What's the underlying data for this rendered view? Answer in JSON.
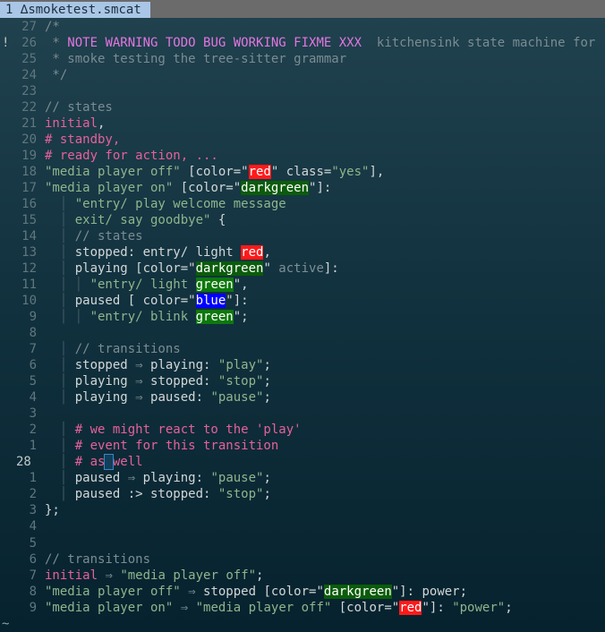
{
  "tab": {
    "number": "1",
    "icon": "linux-icon",
    "filename": "smoketest.smcat"
  },
  "cursor_line": "28",
  "lines": [
    {
      "n": "27",
      "s": [
        [
          "/*",
          "cm"
        ]
      ]
    },
    {
      "n": "26",
      "sign": "!",
      "s": [
        [
          " * ",
          "cm"
        ],
        [
          "NOTE WARNING TODO BUG WORKING FIXME XXX",
          "todo"
        ],
        [
          "  kitchensink state machine for",
          "cm"
        ]
      ]
    },
    {
      "n": "25",
      "s": [
        [
          " * smoke testing the tree-sitter grammar",
          "cm"
        ]
      ]
    },
    {
      "n": "24",
      "s": [
        [
          " */",
          "cm"
        ]
      ]
    },
    {
      "n": "23",
      "s": []
    },
    {
      "n": "22",
      "s": [
        [
          "// states",
          "cm"
        ]
      ]
    },
    {
      "n": "21",
      "s": [
        [
          "initial",
          "kw"
        ],
        [
          ",",
          "tx"
        ]
      ]
    },
    {
      "n": "20",
      "s": [
        [
          "# standby,",
          "kw"
        ]
      ]
    },
    {
      "n": "19",
      "s": [
        [
          "# ready for action, ...",
          "kw"
        ]
      ]
    },
    {
      "n": "18",
      "s": [
        [
          "\"media player off\"",
          "str"
        ],
        [
          " [color=\"",
          "tx"
        ],
        [
          "red",
          "red"
        ],
        [
          "\" class=",
          "tx"
        ],
        [
          "\"yes\"",
          "str"
        ],
        [
          "],",
          "tx"
        ]
      ]
    },
    {
      "n": "17",
      "s": [
        [
          "\"media player on\"",
          "str"
        ],
        [
          " [color=\"",
          "tx"
        ],
        [
          "darkgreen",
          "dg"
        ],
        [
          "\"]:",
          "tx"
        ]
      ]
    },
    {
      "n": "16",
      "s": [
        [
          "  | ",
          "guide"
        ],
        [
          "\"entry/ play welcome message",
          "str"
        ]
      ]
    },
    {
      "n": "15",
      "s": [
        [
          "  | ",
          "guide"
        ],
        [
          "exit/ say goodbye\"",
          "str"
        ],
        [
          " {",
          "tx"
        ]
      ]
    },
    {
      "n": "14",
      "s": [
        [
          "  | ",
          "guide"
        ],
        [
          "// states",
          "cm"
        ]
      ]
    },
    {
      "n": "13",
      "s": [
        [
          "  | ",
          "guide"
        ],
        [
          "stopped: entry/ light ",
          "tx"
        ],
        [
          "red",
          "red"
        ],
        [
          ",",
          "tx"
        ]
      ]
    },
    {
      "n": "12",
      "s": [
        [
          "  | ",
          "guide"
        ],
        [
          "playing [color=\"",
          "tx"
        ],
        [
          "darkgreen",
          "dg"
        ],
        [
          "\" ",
          "tx"
        ],
        [
          "active",
          "op"
        ],
        [
          "]:",
          "tx"
        ]
      ]
    },
    {
      "n": "11",
      "s": [
        [
          "  | | ",
          "guide"
        ],
        [
          "\"entry/ light ",
          "str"
        ],
        [
          "green",
          "g"
        ],
        [
          "\",",
          "tx"
        ]
      ]
    },
    {
      "n": "10",
      "s": [
        [
          "  | ",
          "guide"
        ],
        [
          "paused [ color=\"",
          "tx"
        ],
        [
          "blue",
          "blue"
        ],
        [
          "\"]:",
          "tx"
        ]
      ]
    },
    {
      "n": "9",
      "s": [
        [
          "  | | ",
          "guide"
        ],
        [
          "\"entry/ blink ",
          "str"
        ],
        [
          "green",
          "g"
        ],
        [
          "\";",
          "tx"
        ]
      ]
    },
    {
      "n": "8",
      "s": []
    },
    {
      "n": "7",
      "s": [
        [
          "  | ",
          "guide"
        ],
        [
          "// transitions",
          "cm"
        ]
      ]
    },
    {
      "n": "6",
      "s": [
        [
          "  | ",
          "guide"
        ],
        [
          "stopped ",
          "tx"
        ],
        [
          "⇒",
          "op"
        ],
        [
          " playing: ",
          "tx"
        ],
        [
          "\"play\"",
          "str"
        ],
        [
          ";",
          "tx"
        ]
      ]
    },
    {
      "n": "5",
      "s": [
        [
          "  | ",
          "guide"
        ],
        [
          "playing ",
          "tx"
        ],
        [
          "⇒",
          "op"
        ],
        [
          " stopped: ",
          "tx"
        ],
        [
          "\"stop\"",
          "str"
        ],
        [
          ";",
          "tx"
        ]
      ]
    },
    {
      "n": "4",
      "s": [
        [
          "  | ",
          "guide"
        ],
        [
          "playing ",
          "tx"
        ],
        [
          "⇒",
          "op"
        ],
        [
          " paused: ",
          "tx"
        ],
        [
          "\"pause\"",
          "str"
        ],
        [
          ";",
          "tx"
        ]
      ]
    },
    {
      "n": "3",
      "s": []
    },
    {
      "n": "2",
      "s": [
        [
          "  | ",
          "guide"
        ],
        [
          "# we might react to the 'play'",
          "kw"
        ]
      ]
    },
    {
      "n": "1",
      "s": [
        [
          "  | ",
          "guide"
        ],
        [
          "# event for this transition",
          "kw"
        ]
      ]
    },
    {
      "n": "28",
      "cur": true,
      "s": [
        [
          "  | ",
          "guide"
        ],
        [
          "# as",
          "kw"
        ],
        [
          " ",
          "cursor"
        ],
        [
          "well",
          "kw"
        ]
      ]
    },
    {
      "n": "1",
      "s": [
        [
          "  | ",
          "guide"
        ],
        [
          "paused ",
          "tx"
        ],
        [
          "⇒",
          "op"
        ],
        [
          " playing: ",
          "tx"
        ],
        [
          "\"pause\"",
          "str"
        ],
        [
          ";",
          "tx"
        ]
      ]
    },
    {
      "n": "2",
      "s": [
        [
          "  | ",
          "guide"
        ],
        [
          "paused :> stopped: ",
          "tx"
        ],
        [
          "\"stop\"",
          "str"
        ],
        [
          ";",
          "tx"
        ]
      ]
    },
    {
      "n": "3",
      "s": [
        [
          "};",
          "tx"
        ]
      ]
    },
    {
      "n": "4",
      "s": []
    },
    {
      "n": "5",
      "s": []
    },
    {
      "n": "6",
      "s": [
        [
          "// transitions",
          "cm"
        ]
      ]
    },
    {
      "n": "7",
      "s": [
        [
          "initial",
          "kw"
        ],
        [
          " ",
          "tx"
        ],
        [
          "⇒",
          "op"
        ],
        [
          " ",
          "tx"
        ],
        [
          "\"media player off\"",
          "str"
        ],
        [
          ";",
          "tx"
        ]
      ]
    },
    {
      "n": "8",
      "s": [
        [
          "\"media player off\"",
          "str"
        ],
        [
          " ",
          "tx"
        ],
        [
          "⇒",
          "op"
        ],
        [
          " stopped [color=\"",
          "tx"
        ],
        [
          "darkgreen",
          "dg"
        ],
        [
          "\"]: power;",
          "tx"
        ]
      ]
    },
    {
      "n": "9",
      "s": [
        [
          "\"media player on\"",
          "str"
        ],
        [
          " ",
          "tx"
        ],
        [
          "⇒",
          "op"
        ],
        [
          " ",
          "tx"
        ],
        [
          "\"media player off\"",
          "str"
        ],
        [
          " [color=\"",
          "tx"
        ],
        [
          "red",
          "red"
        ],
        [
          "\"]: ",
          "tx"
        ],
        [
          "\"power\"",
          "str"
        ],
        [
          ";",
          "tx"
        ]
      ]
    }
  ],
  "end_marker": "~"
}
